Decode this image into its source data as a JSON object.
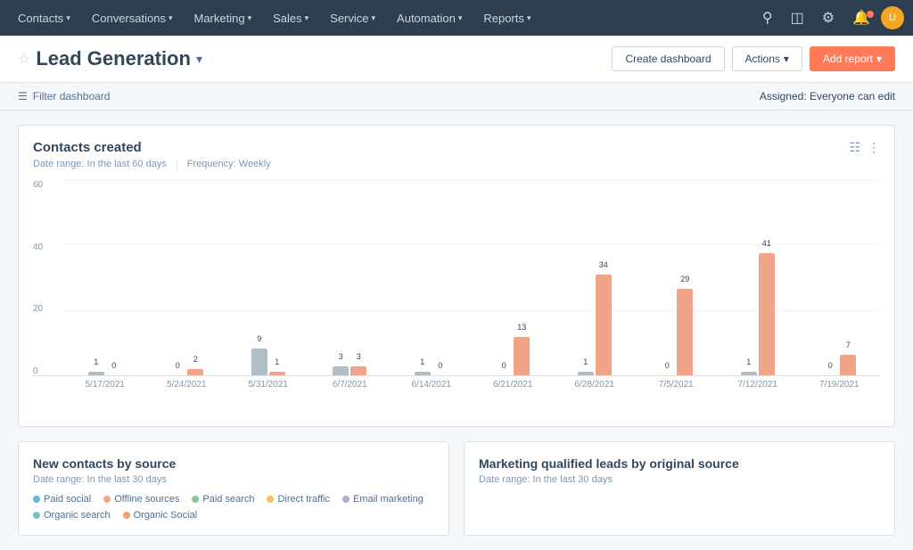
{
  "nav": {
    "items": [
      {
        "label": "Contacts",
        "id": "contacts"
      },
      {
        "label": "Conversations",
        "id": "conversations"
      },
      {
        "label": "Marketing",
        "id": "marketing"
      },
      {
        "label": "Sales",
        "id": "sales"
      },
      {
        "label": "Service",
        "id": "service"
      },
      {
        "label": "Automation",
        "id": "automation"
      },
      {
        "label": "Reports",
        "id": "reports"
      }
    ]
  },
  "header": {
    "title": "Lead Generation",
    "create_dashboard_label": "Create dashboard",
    "actions_label": "Actions",
    "add_report_label": "Add report"
  },
  "toolbar": {
    "filter_label": "Filter dashboard",
    "assigned_label": "Assigned:",
    "assigned_value": "Everyone can edit"
  },
  "chart": {
    "title": "Contacts created",
    "date_range": "Date range: In the last 60 days",
    "frequency": "Frequency: Weekly",
    "y_labels": [
      "0",
      "20",
      "40",
      "60"
    ],
    "bars": [
      {
        "date": "5/17/2021",
        "grey": 1,
        "grey_label": "1",
        "orange": 0,
        "orange_label": "0"
      },
      {
        "date": "5/24/2021",
        "grey": 0,
        "grey_label": "0",
        "orange": 2,
        "orange_label": "2"
      },
      {
        "date": "5/31/2021",
        "grey": 9,
        "grey_label": "9",
        "orange": 1,
        "orange_label": "1"
      },
      {
        "date": "6/7/2021",
        "grey": 3,
        "grey_label": "3",
        "orange": 3,
        "orange_label": "3"
      },
      {
        "date": "6/14/2021",
        "grey": 1,
        "grey_label": "1",
        "orange": 0,
        "orange_label": "0"
      },
      {
        "date": "6/21/2021",
        "grey": 0,
        "grey_label": "0",
        "orange": 13,
        "orange_label": "13"
      },
      {
        "date": "6/28/2021",
        "grey": 1,
        "grey_label": "1",
        "orange": 34,
        "orange_label": "34"
      },
      {
        "date": "7/5/2021",
        "grey": 0,
        "grey_label": "0",
        "orange": 29,
        "orange_label": "29"
      },
      {
        "date": "7/12/2021",
        "grey": 1,
        "grey_label": "1",
        "orange": 41,
        "orange_label": "41"
      },
      {
        "date": "7/19/2021",
        "grey": 0,
        "grey_label": "0",
        "orange": 7,
        "orange_label": "7"
      }
    ]
  },
  "bottom_left": {
    "title": "New contacts by source",
    "date_range": "Date range: In the last 30 days",
    "legend": [
      {
        "label": "Paid social",
        "color": "#6ab4d4"
      },
      {
        "label": "Offline sources",
        "color": "#f0a58a"
      },
      {
        "label": "Paid search",
        "color": "#8ec49a"
      },
      {
        "label": "Direct traffic",
        "color": "#f5c34a"
      },
      {
        "label": "Email marketing",
        "color": "#b5a9d6"
      },
      {
        "label": "Organic search",
        "color": "#7cc4c4"
      },
      {
        "label": "Organic Social",
        "color": "#f5a067"
      }
    ]
  },
  "bottom_right": {
    "title": "Marketing qualified leads by original source",
    "date_range": "Date range: In the last 30 days"
  }
}
